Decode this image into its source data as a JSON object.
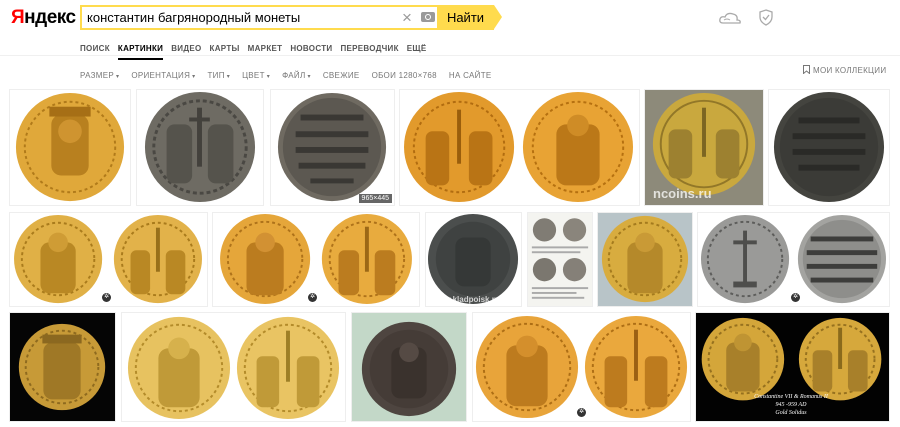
{
  "header": {
    "logo_y": "Я",
    "logo_rest": "ндекс",
    "search_value": "константин багрянородный монеты",
    "find_label": "Найти"
  },
  "tabs": [
    {
      "label": "ПОИСК"
    },
    {
      "label": "КАРТИНКИ"
    },
    {
      "label": "ВИДЕО"
    },
    {
      "label": "КАРТЫ"
    },
    {
      "label": "МАРКЕТ"
    },
    {
      "label": "НОВОСТИ"
    },
    {
      "label": "ПЕРЕВОДЧИК"
    },
    {
      "label": "ЕЩЁ"
    }
  ],
  "filters": [
    {
      "label": "РАЗМЕР",
      "dropdown": true
    },
    {
      "label": "ОРИЕНТАЦИЯ",
      "dropdown": true
    },
    {
      "label": "ТИП",
      "dropdown": true
    },
    {
      "label": "ЦВЕТ",
      "dropdown": true
    },
    {
      "label": "ФАЙЛ",
      "dropdown": true
    },
    {
      "label": "СВЕЖИЕ",
      "dropdown": false
    },
    {
      "label": "ОБОИ 1280×768",
      "dropdown": false
    },
    {
      "label": "НА САЙТЕ",
      "dropdown": false
    }
  ],
  "collections_label": "МОИ КОЛЛЕКЦИИ",
  "results": {
    "badge_size": "965×445",
    "watermark_ncoins": "ncoins.ru",
    "watermark_kladpoisk": "www.kladpoisk.ru",
    "caption_lines": [
      "Constantine VII & Romanus II",
      "945 -959 AD",
      "Gold Solidus"
    ]
  },
  "colors": {
    "accent": "#ffdb4d",
    "logo_red": "#ff0000",
    "gold": "#d9a33a",
    "bronze": "#5b5b57"
  }
}
